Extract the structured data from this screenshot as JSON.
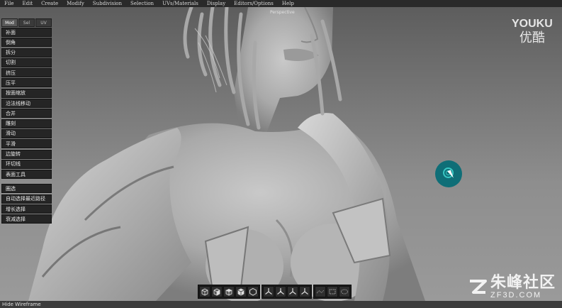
{
  "menubar": {
    "items": [
      "File",
      "Edit",
      "Create",
      "Modify",
      "Subdivision",
      "Selection",
      "UVs/Materials",
      "Display",
      "Editors/Options",
      "Help"
    ]
  },
  "viewport": {
    "label": "Perspective"
  },
  "panel": {
    "tabs": [
      "Mod",
      "Sel",
      "UV"
    ],
    "active_tab": "Mod",
    "tools": [
      "补面",
      "倒角",
      "拆分",
      "切割",
      "挤压",
      "压平",
      "按面缩放",
      "沿法线移动",
      "合并",
      "雕刻",
      "滑动",
      "平滑",
      "边旋转",
      "环切线",
      "表面工具"
    ],
    "selection_tools": [
      "圈选",
      "自动选择最近路径",
      "增长选择",
      "衰减选择"
    ]
  },
  "toolbar": {
    "icons": [
      "view-cube-front-icon",
      "view-cube-side-icon",
      "view-cube-top-icon",
      "view-cube-persp-icon",
      "view-cube-iso-icon",
      "axis-xyz-icon",
      "axis-xy-icon",
      "axis-xz-icon",
      "axis-yz-icon",
      "vertex-select-icon",
      "edge-select-icon",
      "face-select-icon"
    ]
  },
  "status": {
    "text": "Hide Wireframe"
  },
  "watermarks": {
    "youku_en": "YOUKU",
    "youku_cn": "优酷",
    "zf_cn": "朱峰社区",
    "zf_en": "ZF3D.COM"
  },
  "colors": {
    "accent_cursor": "#0f6e77",
    "cursor_ring": "#39c8c4",
    "panel_bg": "#252525"
  }
}
